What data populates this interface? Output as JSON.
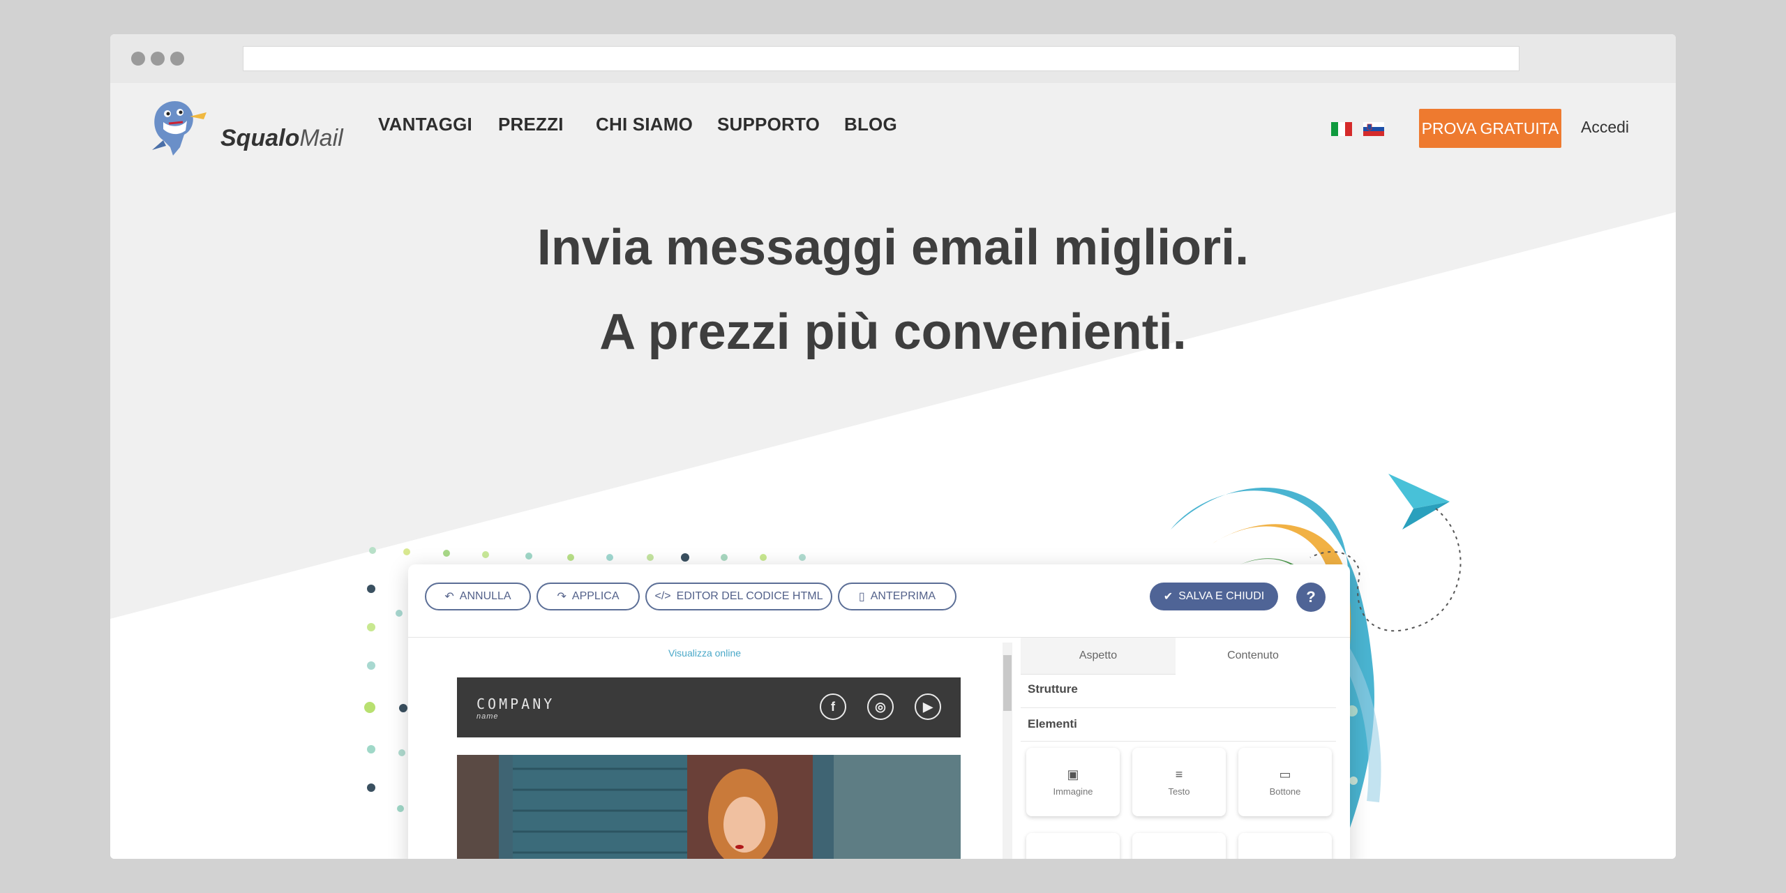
{
  "browser": {
    "url": ""
  },
  "header": {
    "logo": {
      "bold": "Squalo",
      "light": "Mail",
      "icon": "shark-mascot-icon"
    },
    "nav": [
      "VANTAGGI",
      "PREZZI",
      "CHI SIAMO",
      "SUPPORTO",
      "BLOG"
    ],
    "flags": [
      "italy-flag-icon",
      "slovenia-flag-icon"
    ],
    "cta_label": "PROVA GRATUITA",
    "login_label": "Accedi"
  },
  "hero": {
    "line1": "Invia messaggi email migliori.",
    "line2": "A prezzi più convenienti."
  },
  "editor": {
    "toolbar": {
      "undo": "ANNULLA",
      "apply": "APPLICA",
      "html_editor": "EDITOR DEL CODICE HTML",
      "preview": "ANTEPRIMA",
      "save_close": "SALVA E CHIUDI",
      "help": "?"
    },
    "canvas": {
      "view_online": "Visualizza online",
      "company": "COMPANY",
      "company_sub": "name"
    },
    "panel": {
      "tabs": [
        "Aspetto",
        "Contenuto"
      ],
      "sections": [
        "Strutture",
        "Elementi"
      ],
      "tiles": [
        "Immagine",
        "Testo",
        "Bottone"
      ]
    }
  },
  "colors": {
    "accent": "#ee7a2f",
    "editor_primary": "#4f6496",
    "hero_text": "#3e3e3e",
    "page_gray": "#f0f0f0"
  }
}
